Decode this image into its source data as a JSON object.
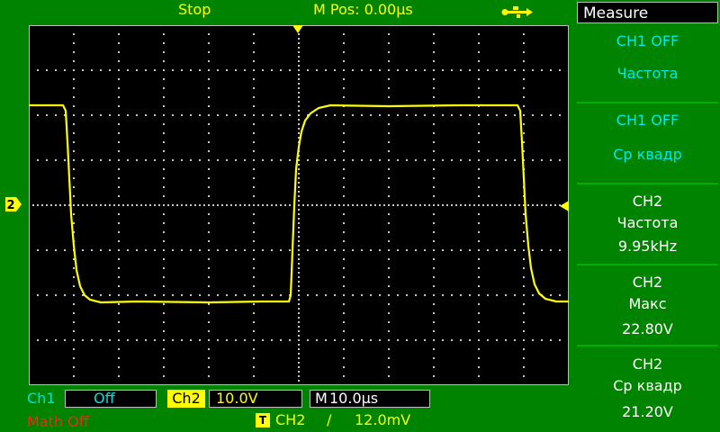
{
  "status": {
    "run_state": "Stop",
    "m_pos": "M Pos: 0.00µs",
    "usb_icon": "usb-icon"
  },
  "channels": {
    "ch1_label": "Ch1",
    "ch1_value": "Off",
    "ch2_label": "Ch2",
    "ch2_value": "10.0V",
    "math": "Math Off",
    "timebase_m": "M",
    "timebase_value": "10.0µs"
  },
  "trigger": {
    "badge": "T",
    "source": "CH2",
    "slope": "∕",
    "level": "12.0mV"
  },
  "menu": {
    "title": "Measure",
    "items": [
      {
        "line1": "CH1   OFF",
        "line2": "Частота",
        "line3": ""
      },
      {
        "line1": "CH1   OFF",
        "line2": "Ср   квадр",
        "line3": ""
      },
      {
        "line1": "CH2",
        "line2": "Частота",
        "line3": "9.95kHz"
      },
      {
        "line1": "CH2",
        "line2": "Макс",
        "line3": "22.80V"
      },
      {
        "line1": "CH2",
        "line2": "Ср   квадр",
        "line3": "21.20V"
      }
    ]
  },
  "markers": {
    "ch2_marker": "2"
  },
  "colors": {
    "background": "#008400",
    "trace": "#ffff00",
    "ch1": "#00e0e0",
    "math": "#ff2020"
  }
}
